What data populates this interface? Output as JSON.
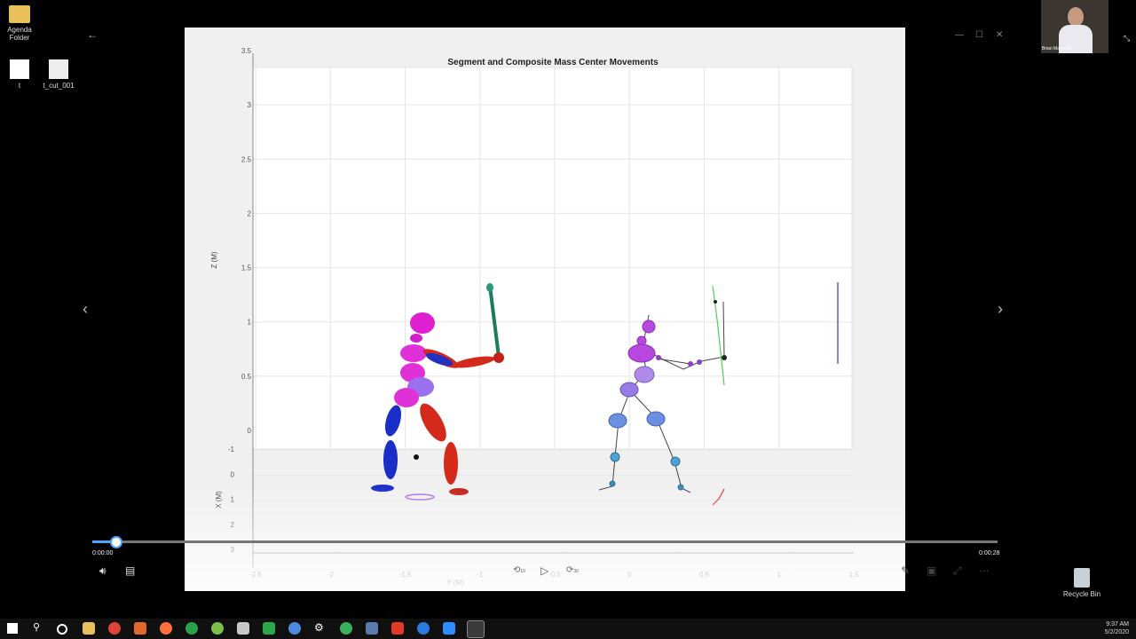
{
  "desktop": {
    "icons": [
      {
        "label": "Agenda\nFolder",
        "icon": "folder-icon"
      },
      {
        "label": "t",
        "icon": "file-icon"
      },
      {
        "label": "t_cut_001",
        "icon": "video-file-icon"
      }
    ],
    "recycle_bin": "Recycle Bin"
  },
  "webcam": {
    "name": "Brian Manzella"
  },
  "player": {
    "back_icon": "back-arrow-icon",
    "current_time": "0:00:00",
    "total_time": "0:00:28",
    "progress_fraction": 0.025,
    "rewind_label": "10",
    "forward_label": "30",
    "controls": [
      "volume-icon",
      "captions-icon",
      "rewind-icon",
      "play-icon",
      "forward-icon",
      "edit-icon",
      "miniplayer-icon",
      "fullscreen-icon",
      "more-icon"
    ]
  },
  "chart_data": {
    "type": "scatter",
    "title": "Segment and Composite Mass Center Movements",
    "zlabel": "Z (M)",
    "xlabel": "X (M)",
    "ylabel": "Y (M)",
    "z_ticks": [
      "3.5",
      "3",
      "2.5",
      "2",
      "1.5",
      "1",
      "0.5",
      "0"
    ],
    "x_ticks": [
      "-1",
      "0",
      "1",
      "2",
      "3"
    ],
    "y_ticks": [
      "-2.5",
      "-2",
      "-1.5",
      "-1",
      "-0.5",
      "0",
      "0.5",
      "1",
      "1.5"
    ],
    "zlim": [
      0,
      3.5
    ],
    "xlim": [
      -1,
      3
    ],
    "ylim": [
      -2.5,
      1.5
    ],
    "grid": true
  },
  "taskbar": {
    "time": "9:37 AM",
    "date": "5/2/2020"
  }
}
